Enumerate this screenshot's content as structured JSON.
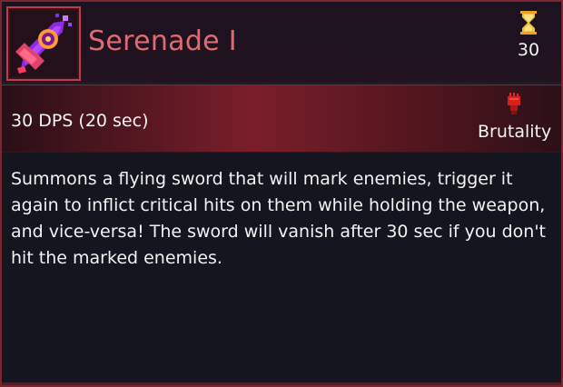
{
  "item": {
    "name": "Serenade I",
    "icon": "purple-sword-icon",
    "time": "30"
  },
  "stats": {
    "dps": "30 DPS (20 sec)",
    "category": "Brutality",
    "category_icon": "fist-icon"
  },
  "description": "Summons a flying sword that will mark enemies, trigger it again to inflict critical hits on them while holding the weapon, and vice-versa! The sword will vanish after 30 sec if you don't hit the marked enemies.",
  "colors": {
    "name": "#e06a70",
    "border": "#c33a4a",
    "band_accent": "#7a1e2a",
    "text": "#f2f2f2"
  }
}
